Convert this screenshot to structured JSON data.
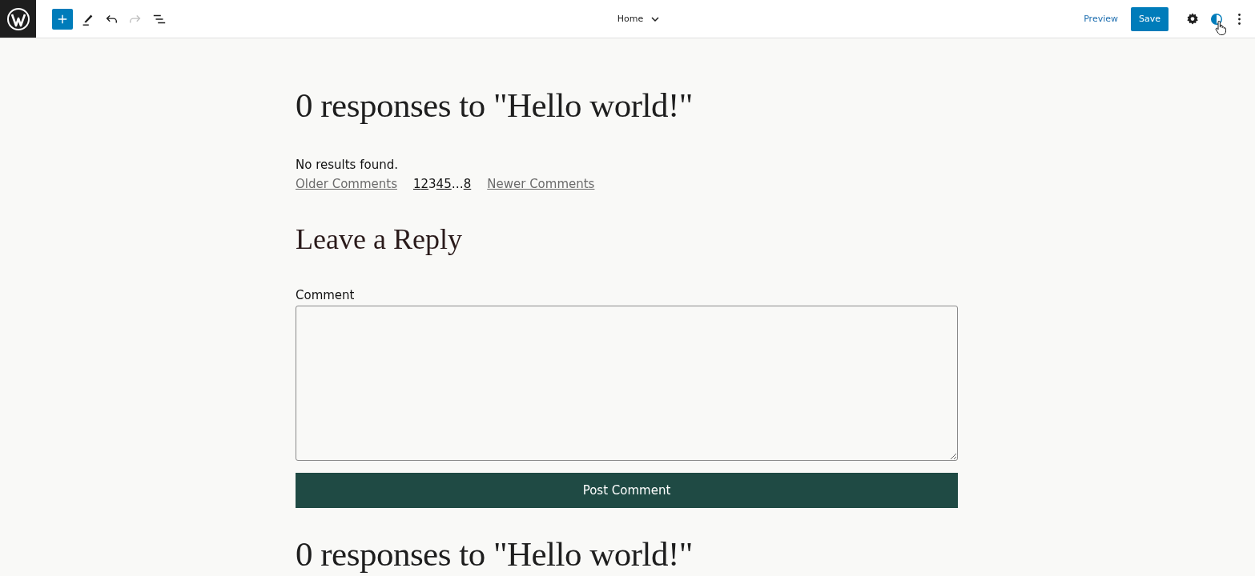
{
  "toolbar": {
    "document_title": "Home",
    "undo_disabled": false,
    "redo_disabled": true,
    "preview": "Preview",
    "save": "Save"
  },
  "content": {
    "heading": "0 responses to \"Hello world!\"",
    "no_results": "No results found.",
    "pagination": {
      "older": "Older Comments",
      "newer": "Newer Comments",
      "pages": [
        {
          "label": "1",
          "selected": false
        },
        {
          "label": "2",
          "selected": false
        },
        {
          "label": "3",
          "selected": true
        },
        {
          "label": "4",
          "selected": false
        },
        {
          "label": "5",
          "selected": false
        },
        {
          "label": "…",
          "kind": "ellipsis"
        },
        {
          "label": "8",
          "selected": false
        }
      ]
    },
    "reply_heading": "Leave a Reply",
    "comment_label": "Comment",
    "submit": "Post Comment",
    "heading_repeat": "0 responses to \"Hello world!\""
  }
}
